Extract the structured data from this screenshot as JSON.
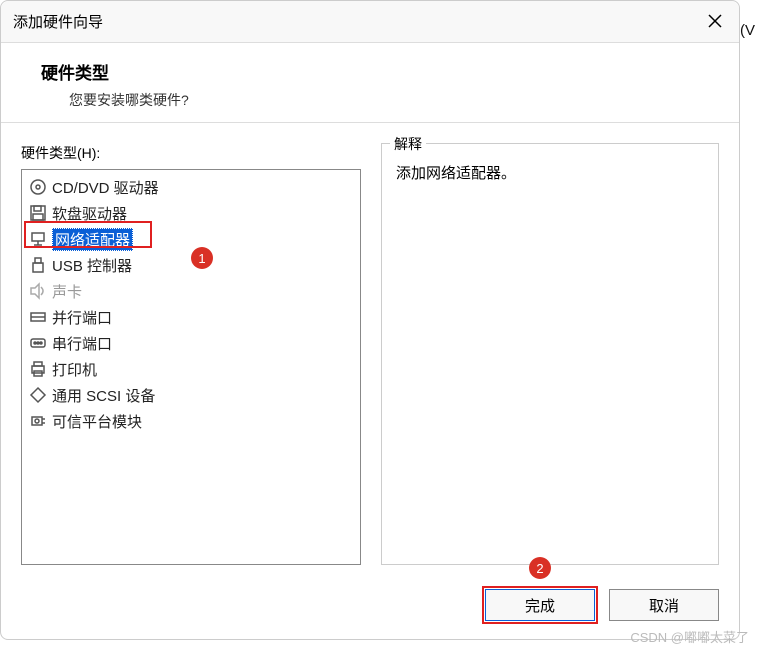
{
  "dialog": {
    "title": "添加硬件向导",
    "header_title": "硬件类型",
    "header_subtitle": "您要安装哪类硬件?"
  },
  "left": {
    "label": "硬件类型(H):",
    "items": [
      {
        "label": "CD/DVD 驱动器",
        "icon": "disc-icon"
      },
      {
        "label": "软盘驱动器",
        "icon": "floppy-icon"
      },
      {
        "label": "网络适配器",
        "icon": "network-icon",
        "selected": true
      },
      {
        "label": "USB 控制器",
        "icon": "usb-icon"
      },
      {
        "label": "声卡",
        "icon": "sound-icon",
        "disabled": true
      },
      {
        "label": "并行端口",
        "icon": "parallel-icon"
      },
      {
        "label": "串行端口",
        "icon": "serial-icon"
      },
      {
        "label": "打印机",
        "icon": "printer-icon"
      },
      {
        "label": "通用 SCSI 设备",
        "icon": "scsi-icon"
      },
      {
        "label": "可信平台模块",
        "icon": "tpm-icon"
      }
    ]
  },
  "right": {
    "label": "解释",
    "text": "添加网络适配器。"
  },
  "footer": {
    "finish": "完成",
    "cancel": "取消"
  },
  "annotations": {
    "marker1": "1",
    "marker2": "2"
  },
  "watermark": "CSDN @嘟嘟太菜了",
  "outside": "(V"
}
